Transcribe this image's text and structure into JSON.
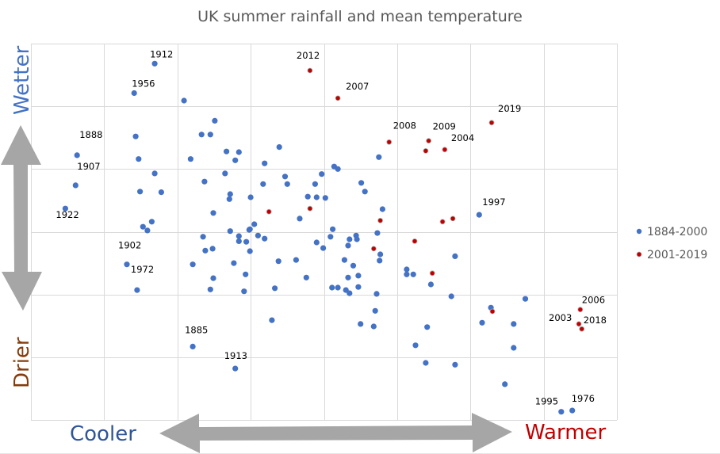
{
  "chart_data": {
    "type": "scatter",
    "title": "UK summer rainfall and mean temperature",
    "xlabel": "",
    "ylabel": "",
    "x_axis_words": {
      "low": "Cooler",
      "high": "Warmer",
      "low_color": "#2f5597",
      "high_color": "#c00000"
    },
    "y_axis_words": {
      "high": "Wetter",
      "low": "Drier",
      "high_color": "#4472c4",
      "low_color": "#843c0c"
    },
    "x_units": "relative temperature (plot grid units, no tick labels shown)",
    "y_units": "relative rainfall (plot grid units, no tick labels shown)",
    "xlim": [
      0,
      8
    ],
    "ylim": [
      0,
      6
    ],
    "grid": true,
    "tick_labels_shown": false,
    "legend_position": "right",
    "series": [
      {
        "name": "1884-2000",
        "color": "#4472c4",
        "points": [
          {
            "x": 1.69,
            "y": 5.68,
            "label": "1912"
          },
          {
            "x": 1.41,
            "y": 5.21,
            "label": "1956"
          },
          {
            "x": 2.09,
            "y": 5.09
          },
          {
            "x": 0.63,
            "y": 4.22,
            "label": "1888"
          },
          {
            "x": 1.43,
            "y": 4.52
          },
          {
            "x": 1.47,
            "y": 4.16
          },
          {
            "x": 2.18,
            "y": 4.16
          },
          {
            "x": 2.33,
            "y": 4.55
          },
          {
            "x": 2.45,
            "y": 4.55
          },
          {
            "x": 2.51,
            "y": 4.77
          },
          {
            "x": 0.61,
            "y": 3.74,
            "label": "1907"
          },
          {
            "x": 0.47,
            "y": 3.37,
            "label": "1922"
          },
          {
            "x": 1.69,
            "y": 3.93
          },
          {
            "x": 1.49,
            "y": 3.64
          },
          {
            "x": 1.78,
            "y": 3.63
          },
          {
            "x": 1.65,
            "y": 3.16
          },
          {
            "x": 1.53,
            "y": 3.08
          },
          {
            "x": 1.59,
            "y": 3.02
          },
          {
            "x": 1.31,
            "y": 2.48,
            "label": "1902"
          },
          {
            "x": 1.45,
            "y": 2.07,
            "label": "1972"
          },
          {
            "x": 2.67,
            "y": 4.28
          },
          {
            "x": 2.84,
            "y": 4.27
          },
          {
            "x": 2.79,
            "y": 4.14
          },
          {
            "x": 3.19,
            "y": 4.09
          },
          {
            "x": 3.39,
            "y": 4.35
          },
          {
            "x": 2.65,
            "y": 3.93
          },
          {
            "x": 2.37,
            "y": 3.8
          },
          {
            "x": 2.72,
            "y": 3.6
          },
          {
            "x": 2.71,
            "y": 3.52
          },
          {
            "x": 3.0,
            "y": 3.55
          },
          {
            "x": 3.17,
            "y": 3.76
          },
          {
            "x": 3.47,
            "y": 3.88
          },
          {
            "x": 3.5,
            "y": 3.76
          },
          {
            "x": 3.78,
            "y": 3.56
          },
          {
            "x": 3.88,
            "y": 3.76
          },
          {
            "x": 3.9,
            "y": 3.55
          },
          {
            "x": 4.02,
            "y": 3.54
          },
          {
            "x": 3.97,
            "y": 3.92
          },
          {
            "x": 4.14,
            "y": 4.04
          },
          {
            "x": 4.19,
            "y": 4.0
          },
          {
            "x": 4.51,
            "y": 3.78
          },
          {
            "x": 4.56,
            "y": 3.64
          },
          {
            "x": 4.75,
            "y": 4.19
          },
          {
            "x": 4.8,
            "y": 3.36
          },
          {
            "x": 2.49,
            "y": 3.3
          },
          {
            "x": 3.67,
            "y": 3.21
          },
          {
            "x": 3.05,
            "y": 3.12
          },
          {
            "x": 2.99,
            "y": 3.04
          },
          {
            "x": 2.98,
            "y": 3.03
          },
          {
            "x": 2.72,
            "y": 3.01
          },
          {
            "x": 2.35,
            "y": 2.92
          },
          {
            "x": 2.84,
            "y": 2.93
          },
          {
            "x": 2.84,
            "y": 2.85
          },
          {
            "x": 3.1,
            "y": 2.94
          },
          {
            "x": 3.19,
            "y": 2.89
          },
          {
            "x": 2.94,
            "y": 2.84
          },
          {
            "x": 2.38,
            "y": 2.7
          },
          {
            "x": 2.48,
            "y": 2.73
          },
          {
            "x": 2.99,
            "y": 2.69
          },
          {
            "x": 2.21,
            "y": 2.48
          },
          {
            "x": 2.77,
            "y": 2.5
          },
          {
            "x": 3.38,
            "y": 2.53
          },
          {
            "x": 3.62,
            "y": 2.55
          },
          {
            "x": 3.76,
            "y": 2.27
          },
          {
            "x": 2.49,
            "y": 2.26
          },
          {
            "x": 2.93,
            "y": 2.32
          },
          {
            "x": 2.45,
            "y": 2.08
          },
          {
            "x": 2.91,
            "y": 2.05
          },
          {
            "x": 3.33,
            "y": 2.1
          },
          {
            "x": 3.29,
            "y": 1.59
          },
          {
            "x": 2.21,
            "y": 1.17,
            "label": "1885"
          },
          {
            "x": 2.79,
            "y": 0.82,
            "label": "1913"
          },
          {
            "x": 3.9,
            "y": 2.83
          },
          {
            "x": 3.99,
            "y": 2.74
          },
          {
            "x": 4.09,
            "y": 2.92
          },
          {
            "x": 4.12,
            "y": 3.04
          },
          {
            "x": 4.35,
            "y": 2.88
          },
          {
            "x": 4.44,
            "y": 2.94
          },
          {
            "x": 4.45,
            "y": 2.88
          },
          {
            "x": 4.33,
            "y": 2.78
          },
          {
            "x": 4.73,
            "y": 2.98
          },
          {
            "x": 4.77,
            "y": 2.64
          },
          {
            "x": 4.76,
            "y": 2.54
          },
          {
            "x": 4.28,
            "y": 2.55
          },
          {
            "x": 4.4,
            "y": 2.46
          },
          {
            "x": 4.33,
            "y": 2.27
          },
          {
            "x": 4.47,
            "y": 2.3
          },
          {
            "x": 4.11,
            "y": 2.11
          },
          {
            "x": 4.19,
            "y": 2.11
          },
          {
            "x": 4.3,
            "y": 2.07
          },
          {
            "x": 4.35,
            "y": 2.02
          },
          {
            "x": 4.47,
            "y": 2.12
          },
          {
            "x": 4.72,
            "y": 2.01
          },
          {
            "x": 4.7,
            "y": 1.74
          },
          {
            "x": 4.5,
            "y": 1.53
          },
          {
            "x": 4.68,
            "y": 1.49
          },
          {
            "x": 5.79,
            "y": 2.61
          },
          {
            "x": 5.13,
            "y": 2.4
          },
          {
            "x": 5.13,
            "y": 2.32
          },
          {
            "x": 5.22,
            "y": 2.32
          },
          {
            "x": 5.46,
            "y": 2.16
          },
          {
            "x": 5.74,
            "y": 1.97
          },
          {
            "x": 5.41,
            "y": 1.48
          },
          {
            "x": 5.25,
            "y": 1.19
          },
          {
            "x": 5.39,
            "y": 0.91
          },
          {
            "x": 5.79,
            "y": 0.88
          },
          {
            "x": 6.12,
            "y": 3.27,
            "label": "1997"
          },
          {
            "x": 6.28,
            "y": 1.79
          },
          {
            "x": 6.75,
            "y": 1.93
          },
          {
            "x": 6.16,
            "y": 1.55
          },
          {
            "x": 6.59,
            "y": 1.53
          },
          {
            "x": 6.59,
            "y": 1.15
          },
          {
            "x": 6.47,
            "y": 0.57
          },
          {
            "x": 7.24,
            "y": 0.13,
            "label": "1995"
          },
          {
            "x": 7.39,
            "y": 0.15,
            "label": "1976"
          }
        ]
      },
      {
        "name": "2001-2019",
        "color": "#c00000",
        "points": [
          {
            "x": 3.81,
            "y": 5.57,
            "label": "2012"
          },
          {
            "x": 4.19,
            "y": 5.13,
            "label": "2007"
          },
          {
            "x": 6.29,
            "y": 4.74,
            "label": "2019"
          },
          {
            "x": 4.89,
            "y": 4.43,
            "label": "2008"
          },
          {
            "x": 5.43,
            "y": 4.45,
            "label": "2009"
          },
          {
            "x": 5.39,
            "y": 4.29
          },
          {
            "x": 5.65,
            "y": 4.31,
            "label": "2004"
          },
          {
            "x": 3.25,
            "y": 3.32
          },
          {
            "x": 3.81,
            "y": 3.37
          },
          {
            "x": 4.77,
            "y": 3.18
          },
          {
            "x": 5.62,
            "y": 3.16
          },
          {
            "x": 5.76,
            "y": 3.21
          },
          {
            "x": 5.24,
            "y": 2.85
          },
          {
            "x": 4.68,
            "y": 2.73
          },
          {
            "x": 5.48,
            "y": 2.34
          },
          {
            "x": 6.3,
            "y": 1.73
          },
          {
            "x": 7.5,
            "y": 1.76,
            "label": "2006"
          },
          {
            "x": 7.48,
            "y": 1.53,
            "label": "2003"
          },
          {
            "x": 7.52,
            "y": 1.45,
            "label": "2018"
          }
        ]
      }
    ]
  }
}
